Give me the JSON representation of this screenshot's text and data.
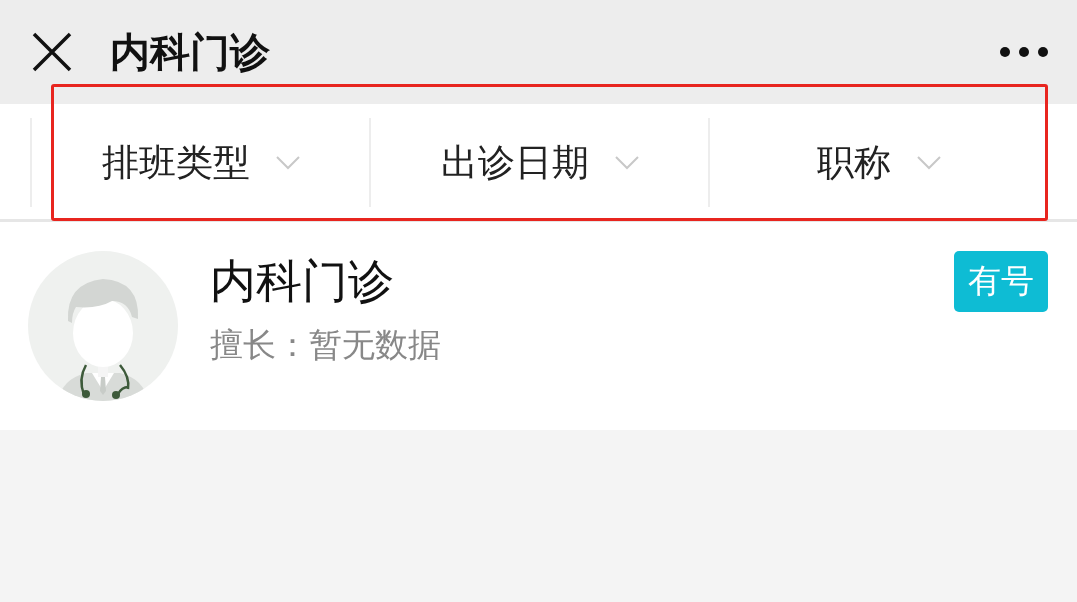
{
  "header": {
    "title": "内科门诊"
  },
  "filters": [
    {
      "label": "排班类型"
    },
    {
      "label": "出诊日期"
    },
    {
      "label": "职称"
    }
  ],
  "doctors": [
    {
      "name": "内科门诊",
      "specialty": "擅长：暂无数据",
      "badge": "有号"
    }
  ]
}
